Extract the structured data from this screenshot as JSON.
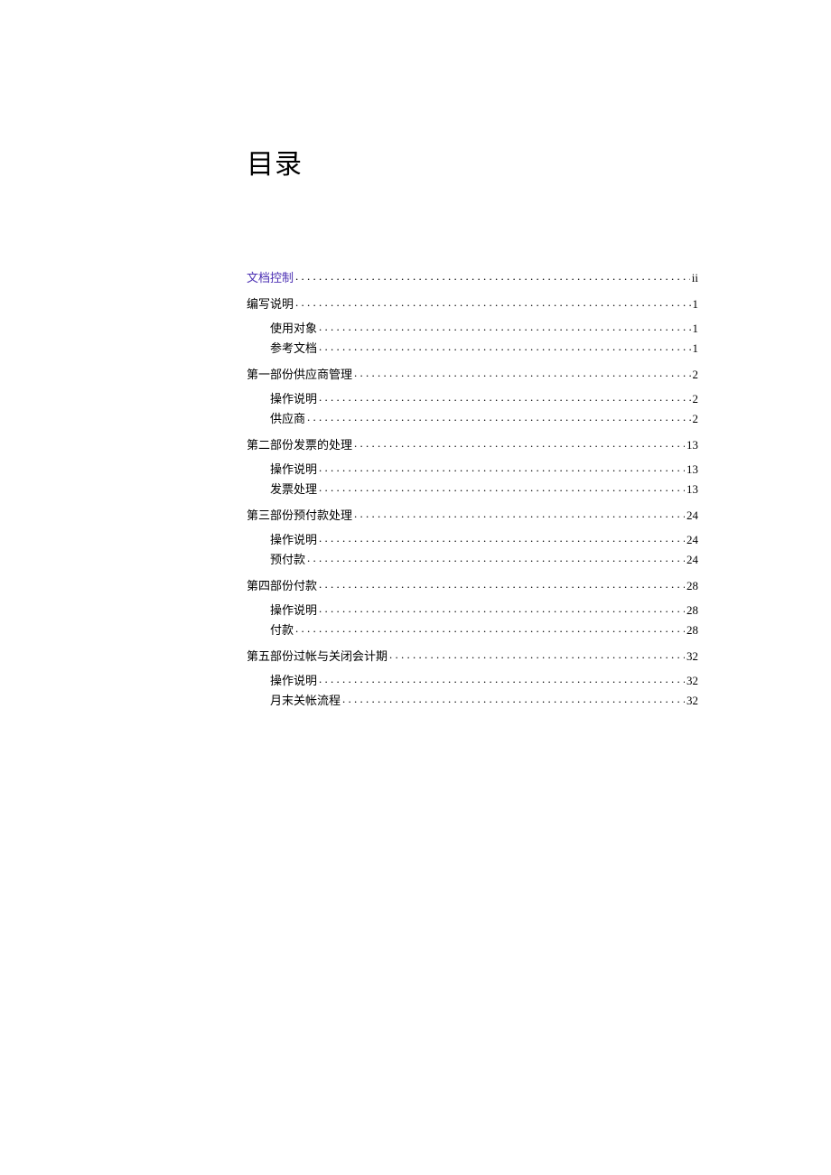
{
  "title": "目录",
  "toc": [
    {
      "level": 0,
      "label": "文档控制",
      "page": "ii",
      "link": true,
      "first": true
    },
    {
      "level": 0,
      "label": "编写说明",
      "page": "1"
    },
    {
      "level": 1,
      "label": "使用对象",
      "page": "1",
      "firstChild": true
    },
    {
      "level": 1,
      "label": "参考文档",
      "page": "1"
    },
    {
      "level": 0,
      "label": "第一部份供应商管理",
      "page": "2"
    },
    {
      "level": 1,
      "label": "操作说明",
      "page": "2",
      "firstChild": true
    },
    {
      "level": 1,
      "label": "供应商",
      "page": "2"
    },
    {
      "level": 0,
      "label": "第二部份发票的处理",
      "page": "13"
    },
    {
      "level": 1,
      "label": "操作说明",
      "page": "13",
      "firstChild": true
    },
    {
      "level": 1,
      "label": "发票处理",
      "page": "13"
    },
    {
      "level": 0,
      "label": "第三部份预付款处理",
      "page": "24"
    },
    {
      "level": 1,
      "label": "操作说明",
      "page": "24",
      "firstChild": true
    },
    {
      "level": 1,
      "label": "预付款",
      "page": "24"
    },
    {
      "level": 0,
      "label": "第四部份付款",
      "page": "28"
    },
    {
      "level": 1,
      "label": "操作说明",
      "page": "28",
      "firstChild": true
    },
    {
      "level": 1,
      "label": "付款",
      "page": "28"
    },
    {
      "level": 0,
      "label": "第五部份过帐与关闭会计期",
      "page": "32"
    },
    {
      "level": 1,
      "label": "操作说明",
      "page": "32",
      "firstChild": true
    },
    {
      "level": 1,
      "label": "月末关帐流程",
      "page": "32"
    }
  ]
}
